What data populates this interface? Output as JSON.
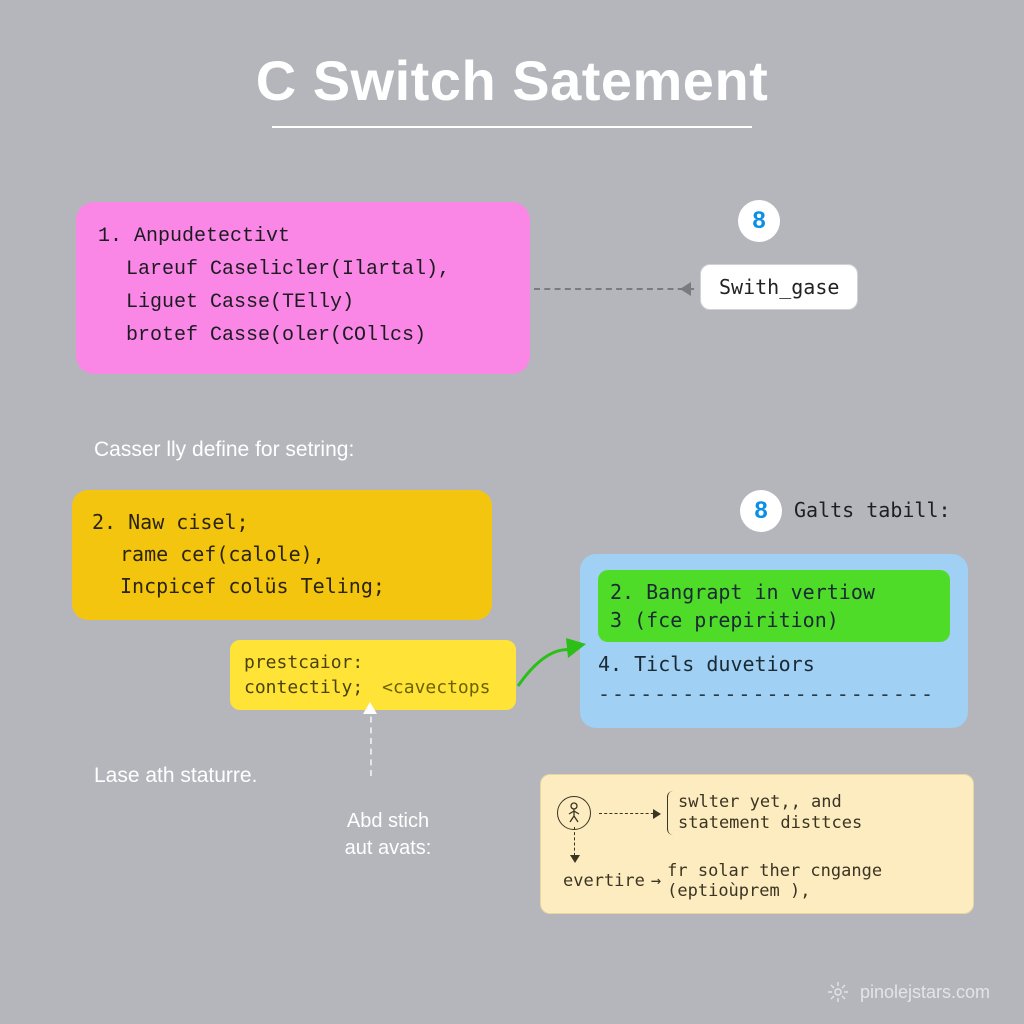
{
  "title": "C Switch Satement",
  "pink_box": {
    "line1": "1. Anpudetectivt",
    "line2": "Lareuf Caselicler(Ilartal),",
    "line3": "Liguet Casse(TElly)",
    "line4": "brotef Casse(oler(COllcs)"
  },
  "badge_top": "8",
  "switch_tag": "Swith_gase",
  "subtitle1": "Casser lly define for setring:",
  "gold_box": {
    "line1": "2. Naw cisel;",
    "line2": "rame cef(calole),",
    "line3": "Incpicef colüs Teling;"
  },
  "yellow_tag": {
    "line1a": "prestcaior:",
    "line1b": "contectily;",
    "tag": "<cavectops"
  },
  "badge_mid": "8",
  "galts_label": "Galts tabill:",
  "blue_box": {
    "green_line1": "2. Bangrapt in vertiow",
    "green_line2": "3 (fce prepirition)",
    "line4": "4. Ticls duvetiors",
    "dashes": "------------------------"
  },
  "lase_label": "Lase ath staturre.",
  "abd_label_line1": "Abd stich",
  "abd_label_line2": "aut avats:",
  "cream_box": {
    "row1_a": "swlter yet,, and",
    "row1_b": "statement disttces",
    "row2_a": "evertire",
    "row2_b": "fr solar ther cngange",
    "row2_c": "(eptioùprem ),"
  },
  "footer": "pinolejstars.com"
}
